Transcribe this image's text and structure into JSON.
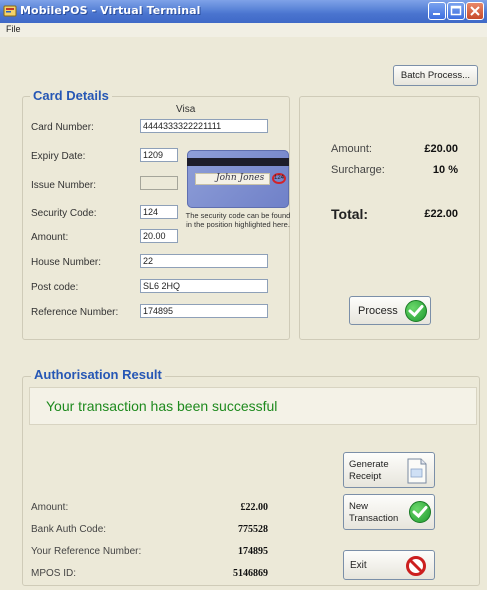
{
  "window": {
    "title": "MobilePOS - Virtual Terminal"
  },
  "menu": {
    "file": "File"
  },
  "toolbar": {
    "batch_process": "Batch Process..."
  },
  "card_details": {
    "heading": "Card Details",
    "card_type": "Visa",
    "labels": {
      "card_number": "Card Number:",
      "expiry_date": "Expiry Date:",
      "issue_number": "Issue Number:",
      "security_code": "Security Code:",
      "amount": "Amount:",
      "house_number": "House Number:",
      "post_code": "Post code:",
      "reference_number": "Reference Number:"
    },
    "values": {
      "card_number": "4444333322221111",
      "expiry_date": "1209",
      "issue_number": "",
      "security_code": "124",
      "amount": "20.00",
      "house_number": "22",
      "post_code": "SL6 2HQ",
      "reference_number": "174895"
    },
    "card_signature": "John Jones",
    "card_cvv": "124",
    "security_hint": "The security code can be found in the position highlighted here."
  },
  "summary": {
    "amount_label": "Amount:",
    "amount_value": "£20.00",
    "surcharge_label": "Surcharge:",
    "surcharge_value": "10 %",
    "total_label": "Total:",
    "total_value": "£22.00",
    "process_button": "Process"
  },
  "authorisation": {
    "heading": "Authorisation Result",
    "message": "Your transaction has been successful",
    "rows": [
      {
        "label": "Amount:",
        "value": "£22.00"
      },
      {
        "label": "Bank Auth Code:",
        "value": "775528"
      },
      {
        "label": "Your Reference Number:",
        "value": "174895"
      },
      {
        "label": "MPOS ID:",
        "value": "5146869"
      }
    ],
    "generate_receipt_line1": "Generate",
    "generate_receipt_line2": "Receipt",
    "new_transaction_line1": "New",
    "new_transaction_line2": "Transaction",
    "exit_button": "Exit"
  },
  "colors": {
    "heading_blue": "#2657b5",
    "success_green": "#1e8a1e",
    "titlebar_blue": "#4a74cf",
    "window_bg": "#ece9d8"
  }
}
